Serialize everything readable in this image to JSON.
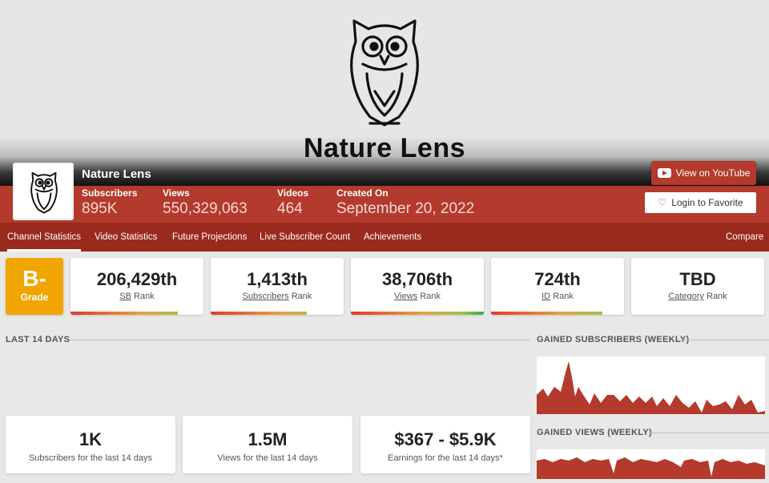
{
  "banner": {
    "title": "Nature Lens",
    "logo_icon": "owl-logo-icon"
  },
  "channel": {
    "name": "Nature Lens",
    "avatar_icon": "owl-avatar-icon",
    "stats": [
      {
        "label": "Subscribers",
        "value": "895K"
      },
      {
        "label": "Views",
        "value": "550,329,063"
      },
      {
        "label": "Videos",
        "value": "464"
      },
      {
        "label": "Created On",
        "value": "September 20, 2022"
      }
    ]
  },
  "actions": {
    "youtube_label": "View on YouTube",
    "favorite_label": "Login to Favorite"
  },
  "nav": {
    "items": [
      "Channel Statistics",
      "Video Statistics",
      "Future Projections",
      "Live Subscriber Count",
      "Achievements"
    ],
    "compare": "Compare"
  },
  "grade": {
    "letter": "B-",
    "label": "Grade",
    "color": "#f1a500"
  },
  "ranks": [
    {
      "value": "206,429th",
      "metric": "SB",
      "suffix": "Rank",
      "bar_fill": 0.81
    },
    {
      "value": "1,413th",
      "metric": "Subscribers",
      "suffix": "Rank",
      "bar_fill": 0.72
    },
    {
      "value": "38,706th",
      "metric": "Views",
      "suffix": "Rank",
      "bar_fill": 1.0
    },
    {
      "value": "724th",
      "metric": "ID",
      "suffix": "Rank",
      "bar_fill": 0.84
    },
    {
      "value": "TBD",
      "metric": "Category",
      "suffix": "Rank",
      "bar_fill": 0
    }
  ],
  "sections": {
    "last14": "LAST 14 DAYS",
    "gained_subs": "GAINED SUBSCRIBERS (WEEKLY)",
    "gained_views": "GAINED VIEWS (WEEKLY)"
  },
  "summary": [
    {
      "value": "1K",
      "label": "Subscribers for the last 14 days"
    },
    {
      "value": "1.5M",
      "label": "Views for the last 14 days"
    },
    {
      "value": "$367 - $5.9K",
      "label": "Earnings for the last 14 days*"
    }
  ],
  "colors": {
    "brand_red": "#b33a2c",
    "nav_red": "#992a1d",
    "chart_red": "#b33a2c"
  }
}
